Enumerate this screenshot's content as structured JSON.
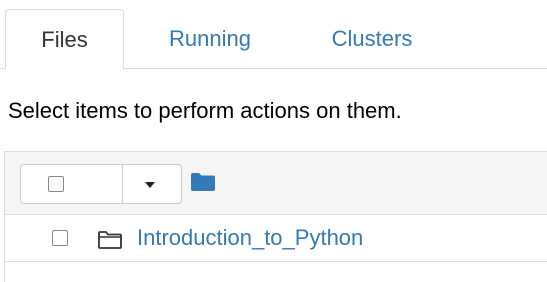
{
  "tabs": [
    {
      "label": "Files",
      "active": true
    },
    {
      "label": "Running",
      "active": false
    },
    {
      "label": "Clusters",
      "active": false
    }
  ],
  "instruction": "Select items to perform actions on them.",
  "toolbar": {
    "select_all_checked": false,
    "dropdown_icon": "caret-down-icon",
    "new_folder_icon": "folder-icon"
  },
  "items": [
    {
      "name": "Introduction_to_Python",
      "type": "folder",
      "icon": "folder-outline-icon",
      "checked": false
    }
  ],
  "colors": {
    "link": "#337ab7",
    "header_bg": "#f5f5f5",
    "border": "#dddddd",
    "text": "#333333"
  }
}
